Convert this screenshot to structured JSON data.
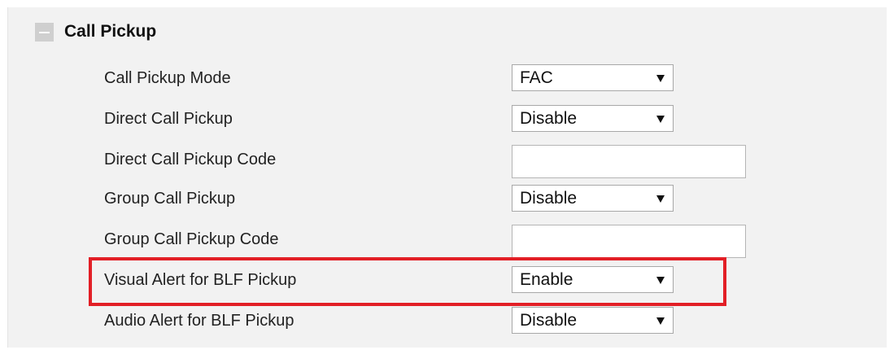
{
  "section": {
    "title": "Call Pickup",
    "collapse_icon": "minus-square-icon"
  },
  "rows": [
    {
      "label": "Call Pickup Mode",
      "type": "select",
      "value": "FAC"
    },
    {
      "label": "Direct Call Pickup",
      "type": "select",
      "value": "Disable"
    },
    {
      "label": "Direct Call Pickup Code",
      "type": "text",
      "value": ""
    },
    {
      "label": "Group Call Pickup",
      "type": "select",
      "value": "Disable"
    },
    {
      "label": "Group Call Pickup Code",
      "type": "text",
      "value": ""
    },
    {
      "label": "Visual Alert for BLF Pickup",
      "type": "select",
      "value": "Enable"
    },
    {
      "label": "Audio Alert for BLF Pickup",
      "type": "select",
      "value": "Disable"
    }
  ],
  "colors": {
    "panel_background": "#f2f2f2",
    "highlight_border": "#e21f26"
  }
}
